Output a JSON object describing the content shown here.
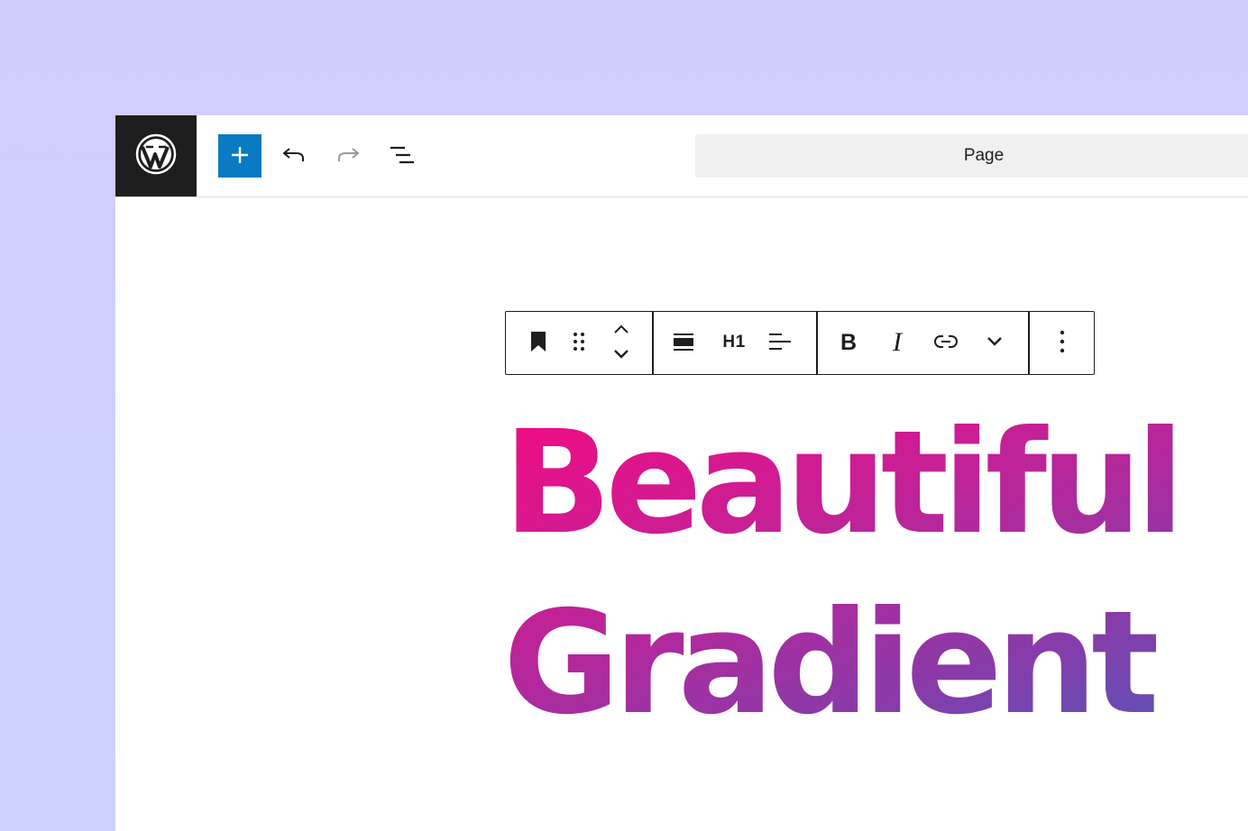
{
  "colors": {
    "background": "#d0cdfd",
    "logo_bg": "#1e1e1e",
    "accent": "#0a7ac2",
    "gradient_start": "#f50a80",
    "gradient_end": "#4f5bbe"
  },
  "topbar": {
    "logo_icon": "wordpress-logo-icon",
    "add_icon": "plus-icon",
    "undo_icon": "undo-icon",
    "redo_icon": "redo-icon",
    "list_view_icon": "list-view-icon",
    "document_title": "Page"
  },
  "block_toolbar": {
    "block_type_icon": "bookmark-icon",
    "drag_icon": "drag-handle-icon",
    "move_up_icon": "chevron-up-icon",
    "move_down_icon": "chevron-down-icon",
    "align_icon": "align-wide-icon",
    "heading_level": "H1",
    "text_align_icon": "align-left-icon",
    "bold_label": "B",
    "italic_label": "I",
    "link_icon": "link-icon",
    "more_formats_icon": "chevron-down-icon",
    "options_icon": "more-vertical-icon"
  },
  "content": {
    "heading_line1": "Beautiful",
    "heading_line2": "Gradient"
  }
}
